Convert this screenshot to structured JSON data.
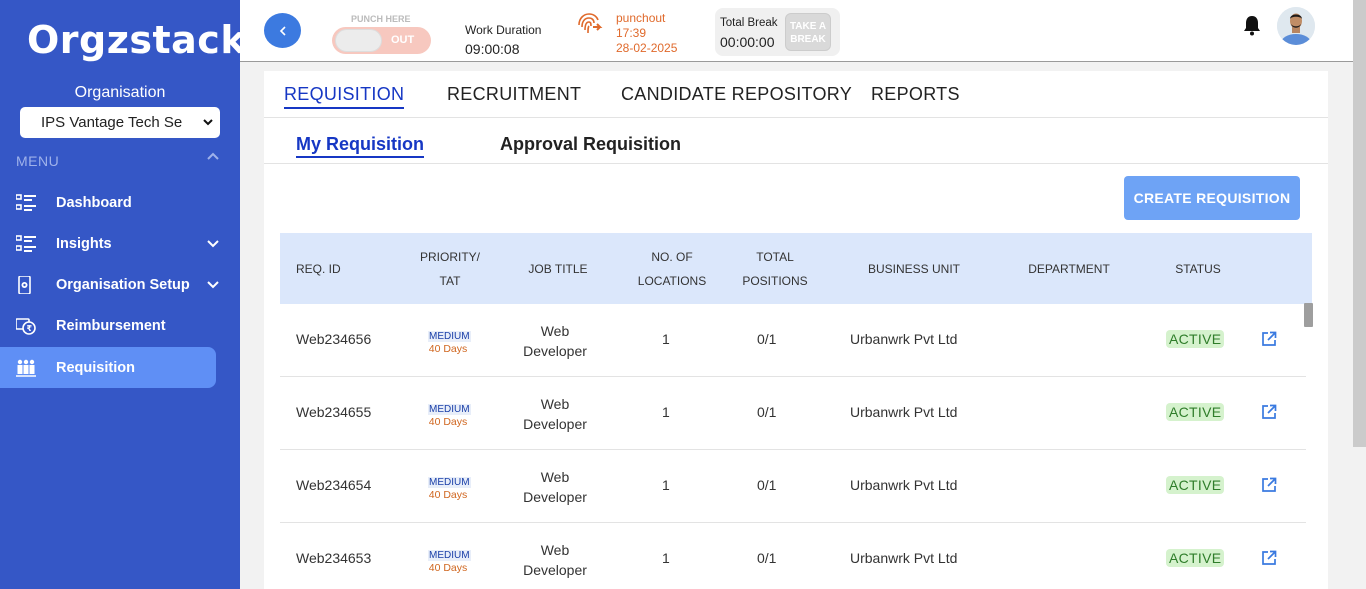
{
  "sidebar": {
    "logo": "Orgzstack",
    "org_label": "Organisation",
    "org_selected": "IPS Vantage Tech Se",
    "menu_label": "MENU",
    "items": [
      {
        "label": "Dashboard",
        "icon": "dashboard-icon"
      },
      {
        "label": "Insights",
        "icon": "insights-icon"
      },
      {
        "label": "Organisation Setup",
        "icon": "organisation-setup-icon"
      },
      {
        "label": "Reimbursement",
        "icon": "reimbursement-icon"
      },
      {
        "label": "Requisition",
        "icon": "requisition-icon"
      }
    ]
  },
  "topbar": {
    "punch_here": "PUNCH HERE",
    "toggle_state": "OUT",
    "work_duration_label": "Work Duration",
    "work_duration_value": "09:00:08",
    "punch_status": "punchout",
    "punch_time": "17:39",
    "punch_date": "28-02-2025",
    "total_break_label": "Total Break",
    "total_break_value": "00:00:00",
    "take_break_label_1": "TAKE A",
    "take_break_label_2": "BREAK"
  },
  "tabs": [
    "REQUISITION",
    "RECRUITMENT",
    "CANDIDATE REPOSITORY",
    "REPORTS"
  ],
  "subtabs": [
    "My Requisition",
    "Approval Requisition"
  ],
  "create_button": "CREATE REQUISITION",
  "table": {
    "headers": {
      "req_id": "REQ. ID",
      "priority_1": "PRIORITY/",
      "priority_2": "TAT",
      "job_title": "JOB TITLE",
      "locations_1": "NO. OF",
      "locations_2": "LOCATIONS",
      "positions_1": "TOTAL",
      "positions_2": "POSITIONS",
      "business_unit": "BUSINESS UNIT",
      "department": "DEPARTMENT",
      "status": "STATUS"
    },
    "rows": [
      {
        "req_id": "Web234656",
        "priority": "MEDIUM",
        "tat": "40 Days",
        "job_title_1": "Web",
        "job_title_2": "Developer",
        "locations": "1",
        "positions": "0/1",
        "business_unit": "Urbanwrk Pvt Ltd",
        "department": "",
        "status": "ACTIVE"
      },
      {
        "req_id": "Web234655",
        "priority": "MEDIUM",
        "tat": "40 Days",
        "job_title_1": "Web",
        "job_title_2": "Developer",
        "locations": "1",
        "positions": "0/1",
        "business_unit": "Urbanwrk Pvt Ltd",
        "department": "",
        "status": "ACTIVE"
      },
      {
        "req_id": "Web234654",
        "priority": "MEDIUM",
        "tat": "40 Days",
        "job_title_1": "Web",
        "job_title_2": "Developer",
        "locations": "1",
        "positions": "0/1",
        "business_unit": "Urbanwrk Pvt Ltd",
        "department": "",
        "status": "ACTIVE"
      },
      {
        "req_id": "Web234653",
        "priority": "MEDIUM",
        "tat": "40 Days",
        "job_title_1": "Web",
        "job_title_2": "Developer",
        "locations": "1",
        "positions": "0/1",
        "business_unit": "Urbanwrk Pvt Ltd",
        "department": "",
        "status": "ACTIVE"
      }
    ]
  },
  "colors": {
    "sidebar": "#3557c6",
    "accent": "#1637c4",
    "button": "#6ea3f5",
    "status_bg": "#d5f2cd",
    "punchout": "#e06a2c"
  }
}
